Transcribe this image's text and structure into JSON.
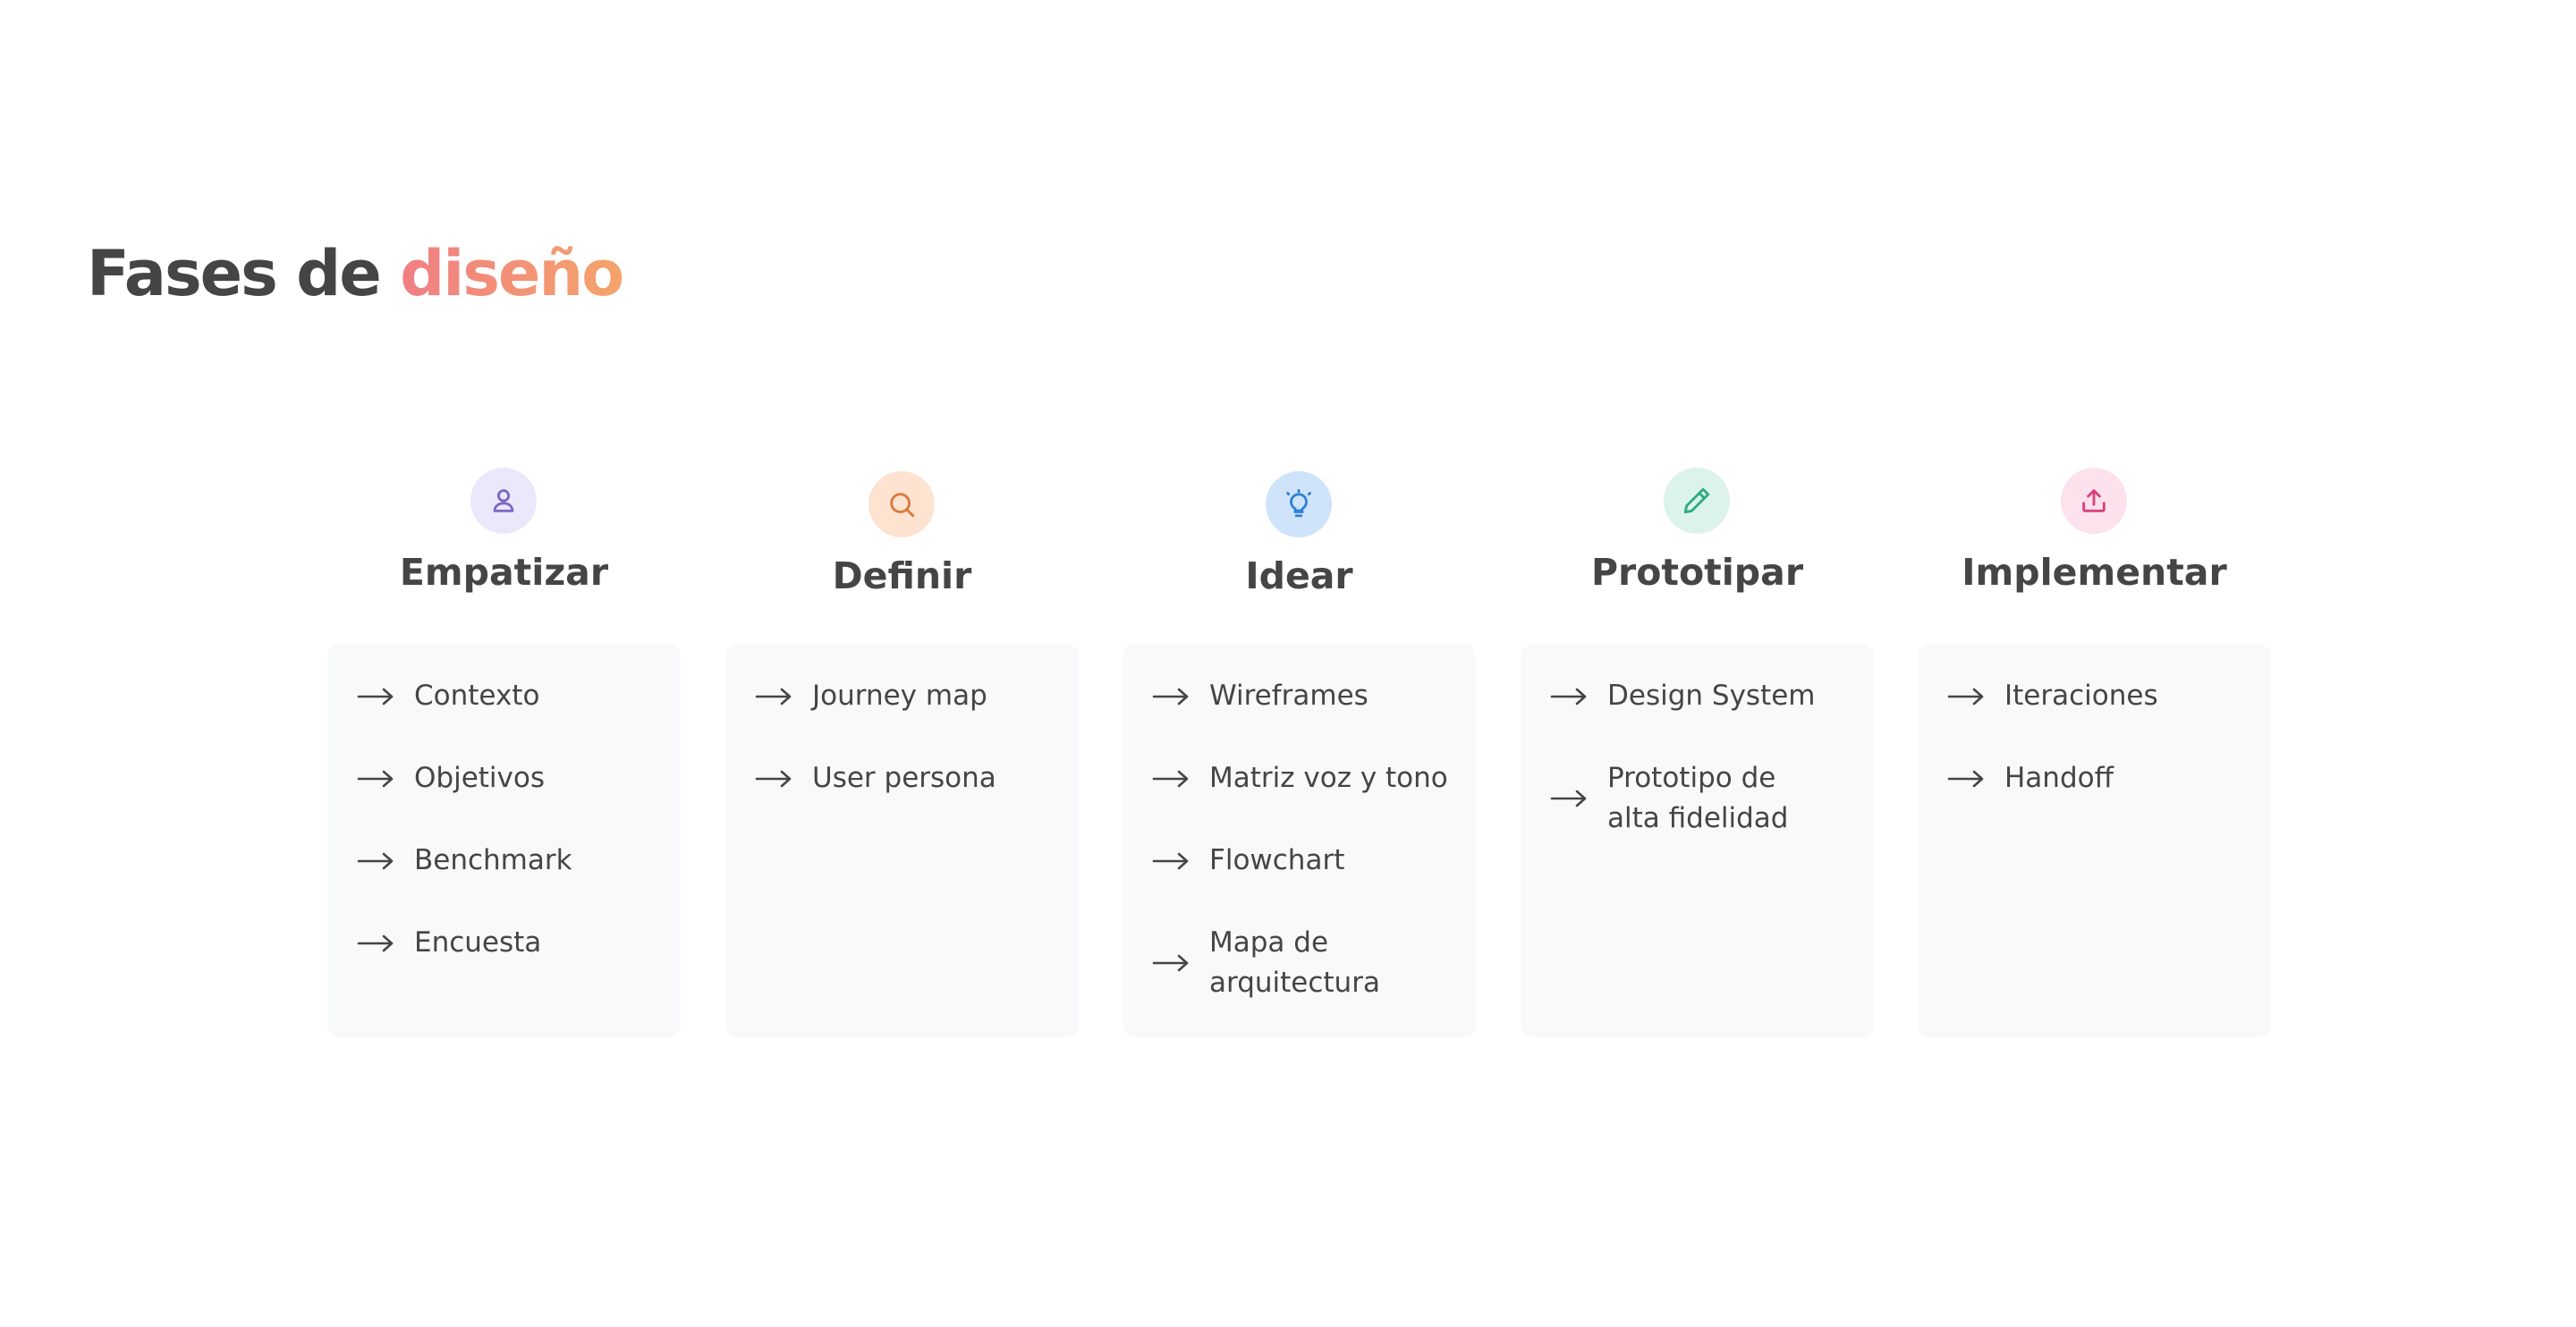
{
  "title": {
    "prefix": "Fases de",
    "accent": "diseño"
  },
  "colors": {
    "text": "#454545",
    "accent_gradient_start": "#f07e84",
    "accent_gradient_end": "#f5a46a",
    "card_background": "#f8f9fb"
  },
  "phases": [
    {
      "title": "Empatizar",
      "icon": "user-icon",
      "icon_color": "#7a68c4",
      "icon_background": "#ece8fb",
      "items": [
        "Contexto",
        "Objetivos",
        "Benchmark",
        "Encuesta"
      ]
    },
    {
      "title": "Definir",
      "icon": "search-icon",
      "icon_color": "#d9783a",
      "icon_background": "#fde3d0",
      "items": [
        "Journey map",
        "User persona"
      ]
    },
    {
      "title": "Idear",
      "icon": "lightbulb-icon",
      "icon_color": "#2f80d6",
      "icon_background": "#cfe3fb",
      "items": [
        "Wireframes",
        "Matriz voz y tono",
        "Flowchart",
        "Mapa de arquitectura"
      ]
    },
    {
      "title": "Prototipar",
      "icon": "pencil-icon",
      "icon_color": "#2faa80",
      "icon_background": "#dcf3ea",
      "items": [
        "Design System",
        "Prototipo de alta fidelidad"
      ]
    },
    {
      "title": "Implementar",
      "icon": "upload-icon",
      "icon_color": "#d8407f",
      "icon_background": "#fde1ec",
      "items": [
        "Iteraciones",
        "Handoff"
      ]
    }
  ]
}
